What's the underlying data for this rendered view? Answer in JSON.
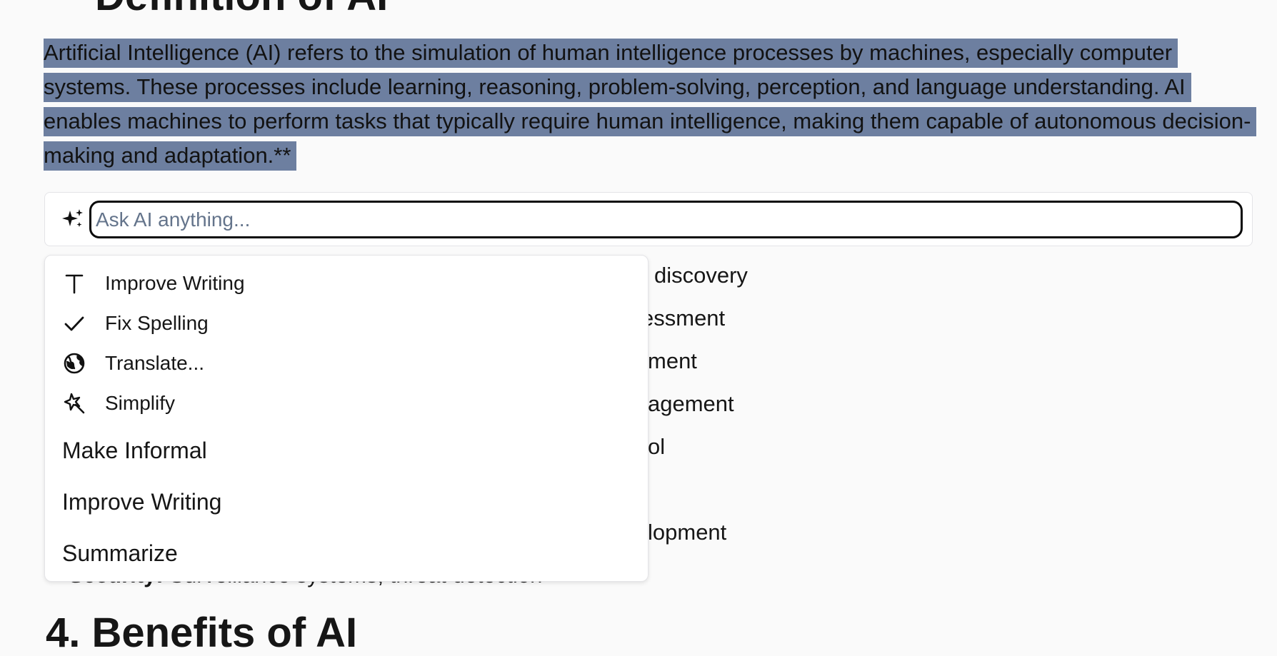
{
  "document": {
    "heading_top": "Definition of AI",
    "paragraph": "Artificial Intelligence (AI) refers to the simulation of human intelligence processes by machines, especially computer systems. These processes include learning, reasoning, problem-solving, perception, and language understanding. AI enables machines to perform tasks that typically require human intelligence, making them capable of autonomous decision-making and adaptation.**",
    "list_fragments": [
      "discovery",
      "essment",
      "ment",
      "agement",
      "ol",
      "lopment"
    ],
    "security_label": "Security:",
    "security_text": " Surveillance systems, threat detection",
    "heading_bottom": "4. Benefits of AI"
  },
  "ask_bar": {
    "icon": "sparkles-icon",
    "placeholder": "Ask AI anything..."
  },
  "menu": {
    "icon_items": [
      {
        "icon": "text-icon",
        "label": "Improve Writing"
      },
      {
        "icon": "check-icon",
        "label": "Fix Spelling"
      },
      {
        "icon": "globe-icon",
        "label": "Translate..."
      },
      {
        "icon": "magic-wand-icon",
        "label": "Simplify"
      }
    ],
    "plain_items": [
      {
        "label": "Make Informal"
      },
      {
        "label": "Improve Writing"
      },
      {
        "label": "Summarize"
      }
    ]
  },
  "colors": {
    "selection": "#6d7fa0",
    "background": "#fafafa",
    "placeholder": "#64748b"
  }
}
